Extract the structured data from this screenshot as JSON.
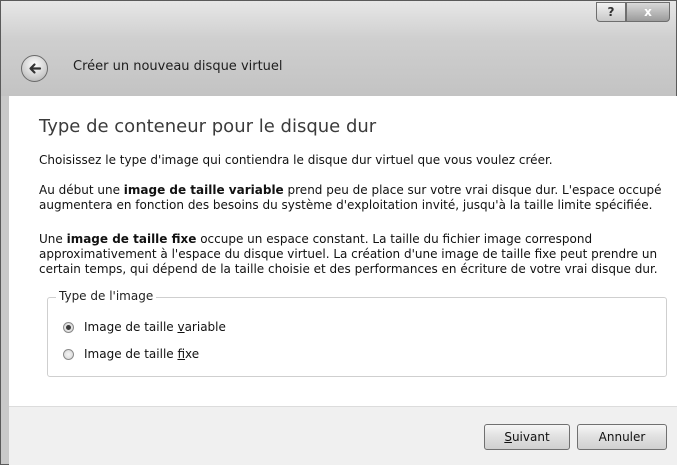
{
  "window": {
    "help_label": "?",
    "close_label": "x"
  },
  "wizard": {
    "title": "Créer un nouveau disque virtuel"
  },
  "page": {
    "heading": "Type de conteneur pour le disque dur",
    "intro": "Choisissez le type d'image qui contiendra le disque dur virtuel que vous voulez créer.",
    "variable_prefix": "Au début une ",
    "variable_bold": "image de taille variable",
    "variable_rest": " prend peu de place sur votre vrai disque dur. L'espace occupé augmentera en fonction des besoins du système d'exploitation invité, jusqu'à la taille limite spécifiée.",
    "fixed_prefix": "Une ",
    "fixed_bold": "image de taille fixe",
    "fixed_rest": " occupe un espace constant. La taille du fichier image correspond approximativement à l'espace du disque virtuel. La création d'une image de taille fixe peut prendre un certain temps, qui dépend de la taille choisie et des performances en écriture de votre vrai disque dur."
  },
  "image_type": {
    "group_label": "Type de l'image",
    "options": [
      {
        "label_before": "Image de taille ",
        "mnemonic": "v",
        "label_after": "ariable",
        "checked": true
      },
      {
        "label_before": "Image de taille ",
        "mnemonic": "f",
        "label_after": "ixe",
        "checked": false
      }
    ]
  },
  "buttons": {
    "next_mnemonic": "S",
    "next_rest": "uivant",
    "cancel": "Annuler"
  },
  "icons": {
    "back": "back-arrow-icon"
  }
}
